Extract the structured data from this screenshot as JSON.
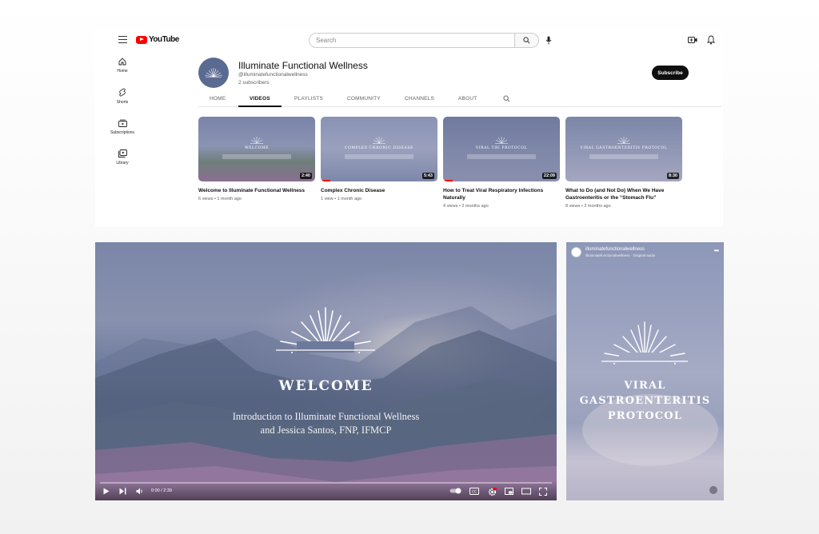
{
  "topbar": {
    "logo_text": "YouTube",
    "search_placeholder": "Search"
  },
  "sidenav": {
    "items": [
      {
        "label": "Home",
        "icon": "home-icon"
      },
      {
        "label": "Shorts",
        "icon": "shorts-icon"
      },
      {
        "label": "Subscriptions",
        "icon": "subscriptions-icon"
      },
      {
        "label": "Library",
        "icon": "library-icon"
      }
    ]
  },
  "channel": {
    "title": "Illuminate Functional Wellness",
    "handle": "@illuminatefunctionalwellness",
    "subscribers": "2 subscribers",
    "subscribe_label": "Subscribe"
  },
  "tabs": [
    "HOME",
    "VIDEOS",
    "PLAYLISTS",
    "COMMUNITY",
    "CHANNELS",
    "ABOUT"
  ],
  "videos": [
    {
      "thumb_label": "WELCOME",
      "duration": "2:40",
      "title": "Welcome to Illuminate Functional Wellness",
      "meta": "6 views • 1 month ago"
    },
    {
      "thumb_label": "COMPLEX CHRONIC DISEASE",
      "duration": "5:43",
      "title": "Complex Chronic Disease",
      "meta": "1 view • 1 month ago"
    },
    {
      "thumb_label": "VIRAL URI PROTOCOL",
      "duration": "22:09",
      "title": "How to Treat Viral Respiratory Infections Naturally",
      "meta": "4 views • 2 months ago"
    },
    {
      "thumb_label": "VIRAL GASTROENTERITIS PROTOCOL",
      "duration": "8:30",
      "title": "What to Do (and Not Do) When We Have Gastroenteritis or the “Stomach Flu”",
      "meta": "8 views • 2 months ago"
    }
  ],
  "player": {
    "title": "WELCOME",
    "subtitle_line1": "Introduction to Illuminate Functional Wellness",
    "subtitle_line2": "and Jessica Santos, FNP, IFMCP",
    "timecode": "0:00 / 2:39"
  },
  "short": {
    "account": "illuminatefunctionalwellness",
    "audio": "illuminatefunctionalwellness · Original audio",
    "title_lines": [
      "VIRAL",
      "GASTROENTERITIS",
      "PROTOCOL"
    ]
  },
  "colors": {
    "brand_red": "#ff0000",
    "avatar_bg": "#5b6a91",
    "subscribe_bg": "#0f0f0f"
  }
}
